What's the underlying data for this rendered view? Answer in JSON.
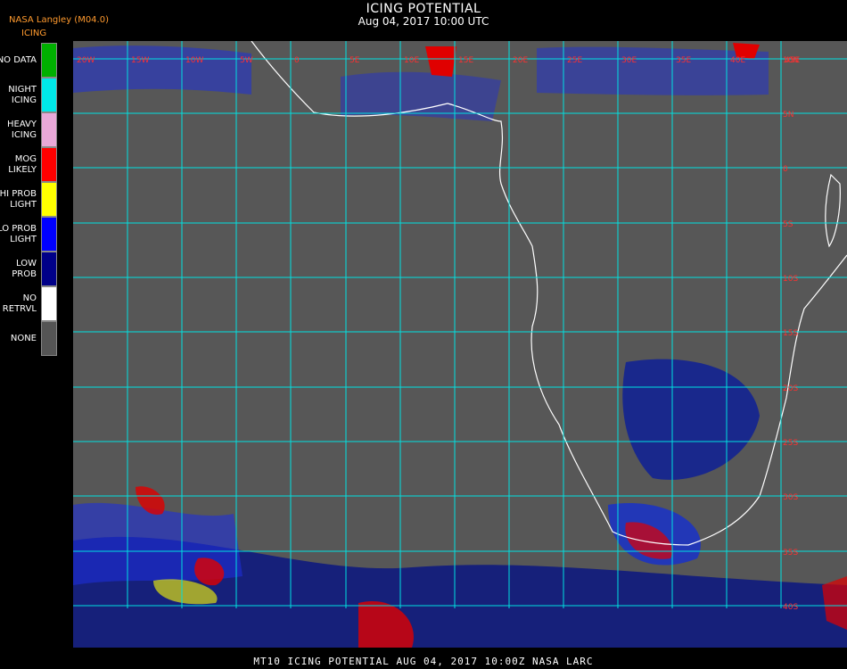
{
  "header": {
    "title": "ICING POTENTIAL",
    "subtitle": "Aug 04, 2017 10:00 UTC",
    "source": "NASA Langley (M04.0)",
    "product": "ICING"
  },
  "legend": [
    {
      "label": "NO DATA",
      "color": "#00b000"
    },
    {
      "label": "NIGHT\nICING",
      "color": "#00e8e8"
    },
    {
      "label": "HEAVY\nICING",
      "color": "#e8a8d8"
    },
    {
      "label": "MOG\nLIKELY",
      "color": "#ff0000"
    },
    {
      "label": "HI PROB\nLIGHT",
      "color": "#ffff00"
    },
    {
      "label": "LO PROB\nLIGHT",
      "color": "#0000ff"
    },
    {
      "label": "LOW\nPROB",
      "color": "#000088"
    },
    {
      "label": "NO\nRETRVL",
      "color": "#ffffff"
    },
    {
      "label": "NONE",
      "color": "#555555"
    }
  ],
  "map": {
    "background_color": "#575757",
    "grid_color": "#00e0e0",
    "coastline_color": "#ffffff",
    "lon_labels": [
      "20W",
      "15W",
      "10W",
      "5W",
      "0",
      "5E",
      "10E",
      "15E",
      "20E",
      "25E",
      "30E",
      "35E",
      "40E",
      "45E"
    ],
    "lat_labels": [
      "10N",
      "5N",
      "0",
      "5S",
      "10S",
      "15S",
      "20S",
      "25S",
      "30S",
      "35S",
      "40S"
    ]
  },
  "footer": "MT10  ICING POTENTIAL   AUG 04, 2017 10:00Z   NASA LARC"
}
